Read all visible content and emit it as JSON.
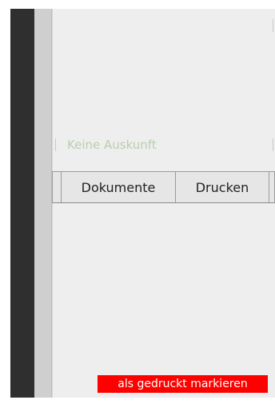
{
  "status": {
    "label": "Keine Auskunft"
  },
  "tabs": [
    {
      "label": ""
    },
    {
      "label": "Dokumente"
    },
    {
      "label": "Drucken"
    },
    {
      "label": ""
    }
  ],
  "actions": {
    "mark_printed_label": "als gedruckt markieren"
  },
  "colors": {
    "accent_button": "#ff0000",
    "status_text": "#b9cfae",
    "panel_background": "#eeeeee"
  }
}
